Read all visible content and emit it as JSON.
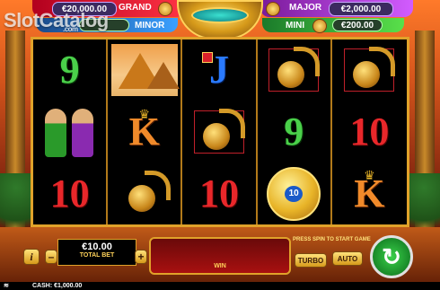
{
  "jackpots": {
    "grand": {
      "label": "GRAND",
      "value": "€20,000.00"
    },
    "major": {
      "label": "MAJOR",
      "value": "€2,000.00"
    },
    "minor": {
      "label": "MINOR",
      "value": ""
    },
    "mini": {
      "label": "MINI",
      "value": "€200.00"
    }
  },
  "watermark": {
    "text": "SlotCatalog",
    "suffix": ".com"
  },
  "reels": [
    [
      "9",
      "pyramids-symbol",
      "J",
      "scorpion-symbol",
      "scorpion-symbol"
    ],
    [
      "dancers-symbol",
      "K",
      "scorpion-symbol",
      "9",
      "10"
    ],
    [
      "10",
      "scorpion-symbol",
      "10",
      "coin-10-symbol",
      "K"
    ]
  ],
  "coin_value": "10",
  "controls": {
    "info_label": "i",
    "minus_label": "–",
    "plus_label": "+",
    "bet_value": "€10.00",
    "bet_label": "TOTAL BET",
    "win_label": "WIN",
    "message": "PRESS SPIN TO START GAME",
    "turbo_label": "TURBO",
    "auto_label": "AUTO",
    "spin_icon": "↻"
  },
  "footer": {
    "cash_label": "CASH:",
    "cash_value": "€1,000.00"
  },
  "colors": {
    "reel_border": "#e0a22a",
    "spin_green": "#3ad04a"
  }
}
